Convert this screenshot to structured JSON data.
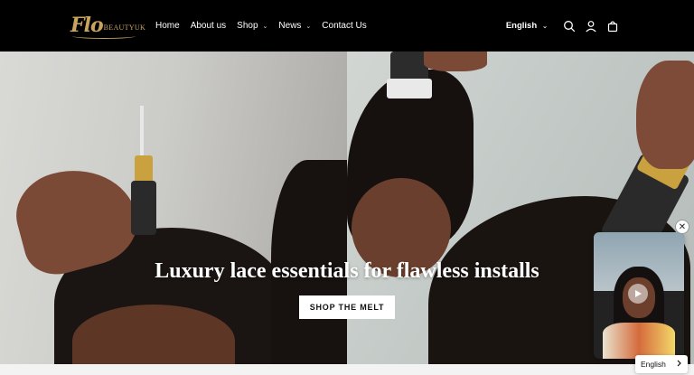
{
  "brand": {
    "logo_script": "Flo",
    "logo_sub": "BEAUTYUK"
  },
  "nav": {
    "items": [
      {
        "label": "Home",
        "has_dropdown": false
      },
      {
        "label": "About us",
        "has_dropdown": false
      },
      {
        "label": "Shop",
        "has_dropdown": true
      },
      {
        "label": "News",
        "has_dropdown": true
      },
      {
        "label": "Contact Us",
        "has_dropdown": false
      }
    ]
  },
  "header_actions": {
    "language": "English",
    "icons": [
      "search-icon",
      "account-icon",
      "cart-icon"
    ]
  },
  "hero": {
    "title": "Luxury lace essentials for flawless installs",
    "button_label": "SHOP THE MELT"
  },
  "video_popup": {
    "close_symbol": "✕"
  },
  "language_selector": {
    "label": "English"
  },
  "colors": {
    "header_bg": "#000000",
    "logo_gold": "#c9a45c",
    "button_bg": "#ffffff"
  }
}
